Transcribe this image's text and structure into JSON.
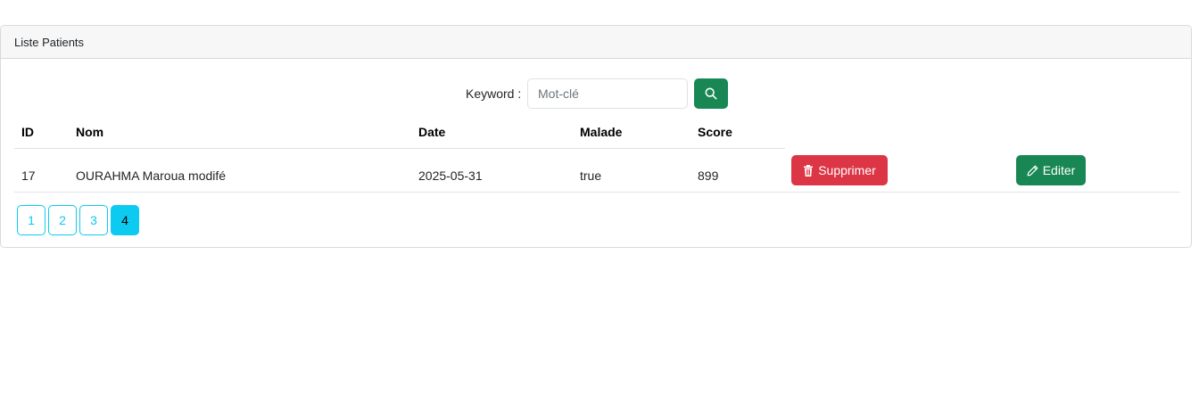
{
  "card": {
    "header_title": "Liste Patients"
  },
  "search": {
    "label": "Keyword :",
    "placeholder": "Mot-clé",
    "value": "",
    "button_icon": "search-icon"
  },
  "table": {
    "columns": [
      "ID",
      "Nom",
      "Date",
      "Malade",
      "Score"
    ],
    "rows": [
      {
        "id": "17",
        "nom": "OURAHMA Maroua modifé",
        "date": "2025-05-31",
        "malade": "true",
        "score": "899",
        "delete_label": "Supprimer",
        "delete_icon": "trash-icon",
        "edit_label": "Editer",
        "edit_icon": "pencil-icon"
      }
    ]
  },
  "pagination": {
    "pages": [
      "1",
      "2",
      "3",
      "4"
    ],
    "current": "4"
  },
  "colors": {
    "primary_success": "#198754",
    "danger": "#dc3545",
    "info": "#0dcaf0"
  }
}
